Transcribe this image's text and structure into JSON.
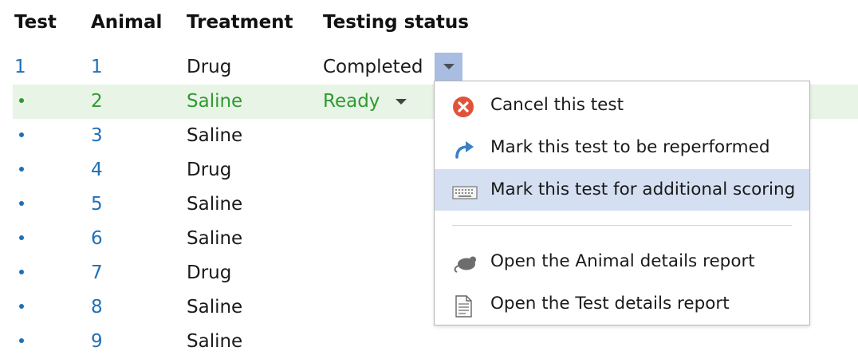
{
  "table": {
    "headers": {
      "test": "Test",
      "animal": "Animal",
      "treatment": "Treatment",
      "status": "Testing status"
    },
    "rows": [
      {
        "test": "1",
        "animal": "1",
        "treatment": "Drug",
        "status": "Completed"
      },
      {
        "test": "•",
        "animal": "2",
        "treatment": "Saline",
        "status": "Ready"
      },
      {
        "test": "•",
        "animal": "3",
        "treatment": "Saline",
        "status": ""
      },
      {
        "test": "•",
        "animal": "4",
        "treatment": "Drug",
        "status": ""
      },
      {
        "test": "•",
        "animal": "5",
        "treatment": "Saline",
        "status": ""
      },
      {
        "test": "•",
        "animal": "6",
        "treatment": "Saline",
        "status": ""
      },
      {
        "test": "•",
        "animal": "7",
        "treatment": "Drug",
        "status": ""
      },
      {
        "test": "•",
        "animal": "8",
        "treatment": "Saline",
        "status": ""
      },
      {
        "test": "•",
        "animal": "9",
        "treatment": "Saline",
        "status": ""
      }
    ]
  },
  "menu": {
    "items": [
      {
        "label": "Cancel this test",
        "icon": "cancel-icon"
      },
      {
        "label": "Mark this test to be reperformed",
        "icon": "redo-arrow-icon"
      },
      {
        "label": "Mark this test for additional scoring",
        "icon": "keyboard-icon"
      },
      {
        "label": "Open the Animal details report",
        "icon": "mouse-animal-icon"
      },
      {
        "label": "Open the Test details report",
        "icon": "document-icon"
      }
    ]
  },
  "colors": {
    "link_blue": "#1f6fb8",
    "selected_green": "#2f9a2f",
    "selected_row_bg": "#e8f4e6",
    "menu_hover_bg": "#d4dff2",
    "dropdown_button_bg": "#a9bde0",
    "cancel_red": "#e0533a"
  }
}
